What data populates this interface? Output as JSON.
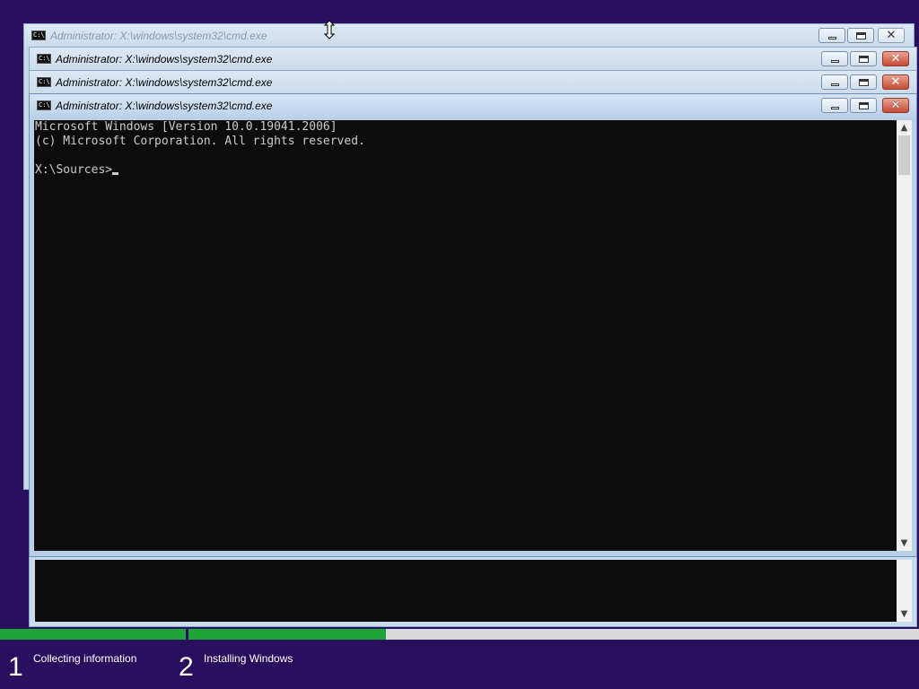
{
  "windows": [
    {
      "title": "Administrator: X:\\windows\\system32\\cmd.exe",
      "state": "inactive",
      "icon": "cmd-icon"
    },
    {
      "title": "Administrator: X:\\windows\\system32\\cmd.exe",
      "state": "inactive",
      "icon": "cmd-icon"
    },
    {
      "title": "Administrator: X:\\windows\\system32\\cmd.exe",
      "state": "inactive",
      "icon": "cmd-icon"
    },
    {
      "title": "Administrator: X:\\windows\\system32\\cmd.exe",
      "state": "active",
      "icon": "cmd-icon"
    }
  ],
  "console": {
    "line1": "Microsoft Windows [Version 10.0.19041.2006]",
    "line2": "(c) Microsoft Corporation. All rights reserved.",
    "line3": "",
    "prompt": "X:\\Sources>"
  },
  "setup": {
    "steps": [
      {
        "number": "1",
        "label": "Collecting information",
        "progress": 1.0
      },
      {
        "number": "2",
        "label": "Installing Windows",
        "progress": 0.27
      }
    ]
  },
  "colors": {
    "desktop": "#28105e",
    "progress": "#1ea439",
    "console_bg": "#0c0c0c",
    "console_fg": "#cccccc"
  },
  "icons": {
    "window": "cmd-icon",
    "minimize": "minimize-icon",
    "maximize": "maximize-icon",
    "close": "close-icon",
    "cursor": "vertical-resize-cursor-icon"
  },
  "ctrl_glyph": {
    "close": "✕"
  },
  "scroll": {
    "up": "▲",
    "down": "▼"
  }
}
